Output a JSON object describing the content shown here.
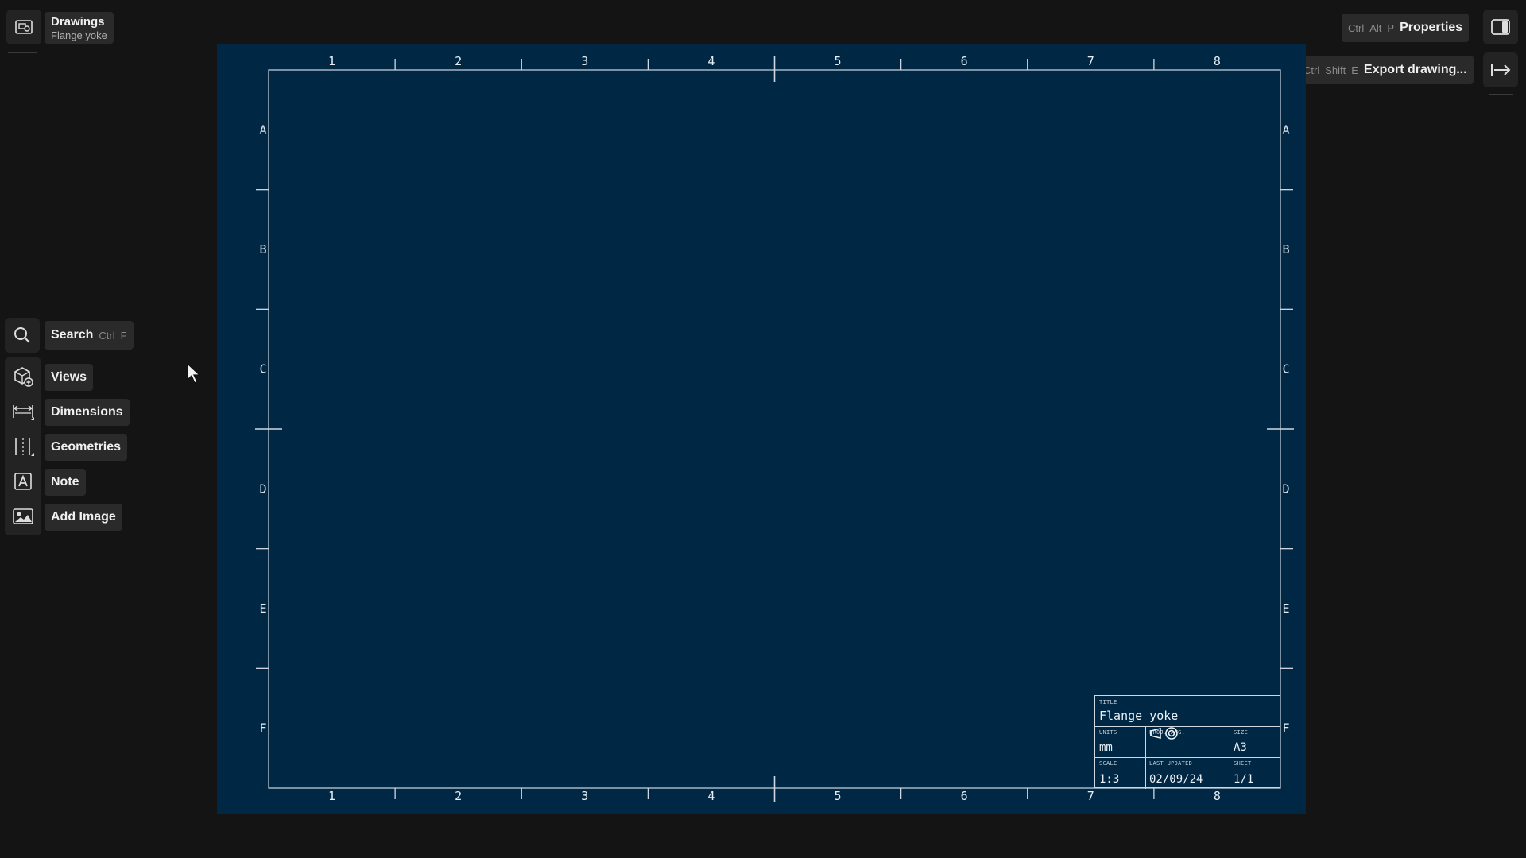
{
  "document": {
    "section": "Drawings",
    "name": "Flange yoke"
  },
  "search": {
    "label": "Search",
    "shortcut": [
      "Ctrl",
      "F"
    ]
  },
  "tools": [
    {
      "label": "Views",
      "icon": "add-view-icon"
    },
    {
      "label": "Dimensions",
      "icon": "dimension-icon"
    },
    {
      "label": "Geometries",
      "icon": "geometry-lines-icon"
    },
    {
      "label": "Note",
      "icon": "note-text-icon"
    },
    {
      "label": "Add Image",
      "icon": "image-icon"
    }
  ],
  "top_right": {
    "properties": {
      "label": "Properties",
      "shortcut": [
        "Ctrl",
        "Alt",
        "P"
      ]
    },
    "export": {
      "label": "Export drawing...",
      "shortcut": [
        "Ctrl",
        "Shift",
        "E"
      ]
    }
  },
  "sheet": {
    "columns": [
      "1",
      "2",
      "3",
      "4",
      "5",
      "6",
      "7",
      "8"
    ],
    "rows": [
      "A",
      "B",
      "C",
      "D",
      "E",
      "F"
    ],
    "colors": {
      "background": "#002845",
      "lines": "#cfd8e0"
    }
  },
  "title_block": {
    "title_caption": "TITLE",
    "title": "Flange yoke",
    "units_caption": "UNITS",
    "units": "mm",
    "proj_caption": "PROJ. ANG.",
    "size_caption": "SIZE",
    "size": "A3",
    "scale_caption": "SCALE",
    "scale": "1:3",
    "updated_caption": "LAST UPDATED",
    "updated": "02/09/24",
    "sheet_caption": "SHEET",
    "sheet": "1/1"
  }
}
